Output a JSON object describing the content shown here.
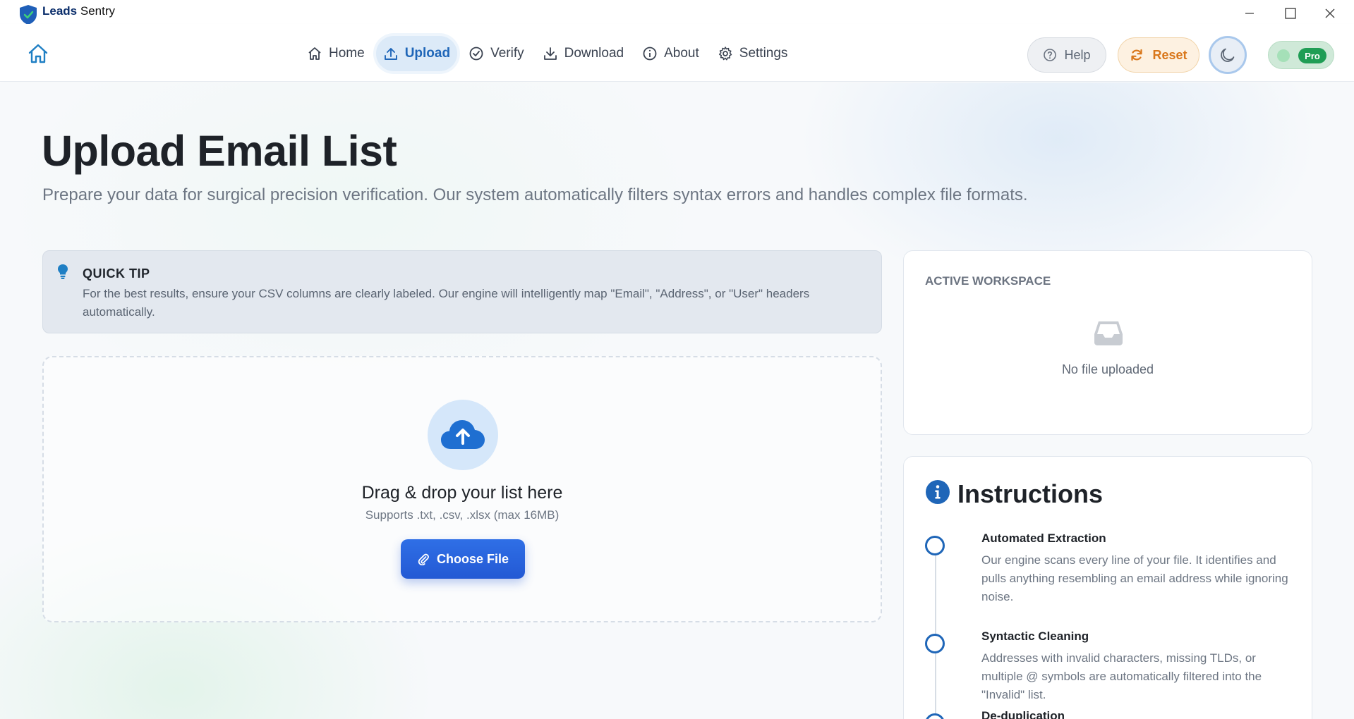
{
  "window": {
    "app_name_bold": "Leads",
    "app_name_rest": "Sentry"
  },
  "nav": {
    "items": [
      {
        "label": "Home",
        "icon": "home-icon",
        "active": false
      },
      {
        "label": "Upload",
        "icon": "upload-icon",
        "active": true
      },
      {
        "label": "Verify",
        "icon": "check-circle-icon",
        "active": false
      },
      {
        "label": "Download",
        "icon": "download-icon",
        "active": false
      },
      {
        "label": "About",
        "icon": "info-icon",
        "active": false
      },
      {
        "label": "Settings",
        "icon": "gear-icon",
        "active": false
      }
    ],
    "help_label": "Help",
    "reset_label": "Reset",
    "pro_label": "Pro"
  },
  "page": {
    "title": "Upload Email List",
    "subtitle": "Prepare your data for surgical precision verification. Our system automatically filters syntax errors and handles complex file formats."
  },
  "tip": {
    "title": "QUICK TIP",
    "body": "For the best results, ensure your CSV columns are clearly labeled. Our engine will intelligently map \"Email\", \"Address\", or \"User\" headers automatically."
  },
  "dropzone": {
    "title": "Drag & drop your list here",
    "subtitle": "Supports .txt, .csv, .xlsx (max 16MB)",
    "button_label": "Choose File"
  },
  "workspace": {
    "title": "ACTIVE WORKSPACE",
    "empty_text": "No file uploaded"
  },
  "instructions": {
    "title": "Instructions",
    "steps": [
      {
        "title": "Automated Extraction",
        "body": "Our engine scans every line of your file. It identifies and pulls anything resembling an email address while ignoring noise."
      },
      {
        "title": "Syntactic Cleaning",
        "body": "Addresses with invalid characters, missing TLDs, or multiple @ symbols are automatically filtered into the \"Invalid\" list."
      },
      {
        "title": "De-duplication",
        "body": ""
      }
    ]
  },
  "colors": {
    "accent": "#1f66b8",
    "primary_button": "#2359d4",
    "reset": "#d9771b",
    "pro": "#1f9d55"
  }
}
